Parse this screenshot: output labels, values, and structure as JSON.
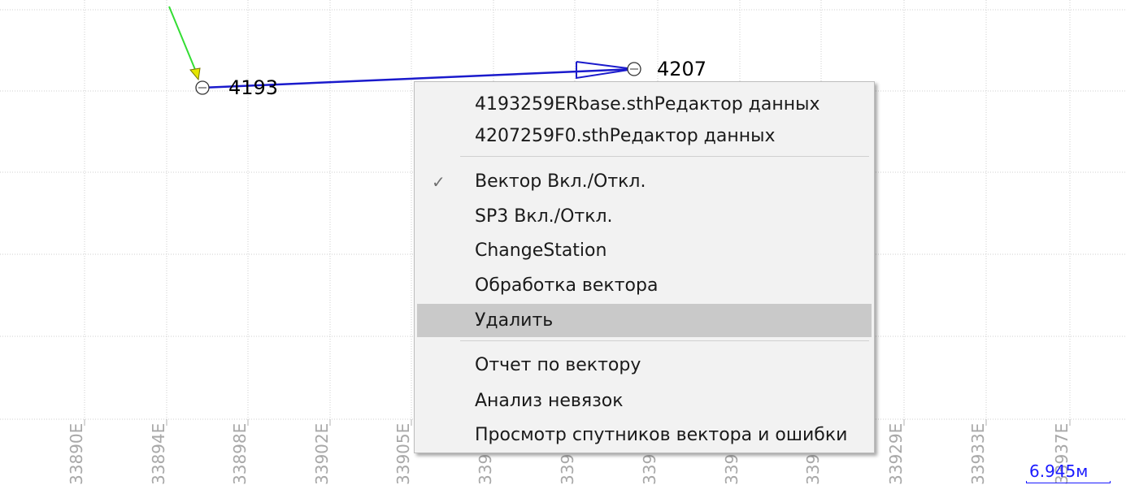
{
  "stations": [
    {
      "id": "4193"
    },
    {
      "id": "4207"
    }
  ],
  "axis_labels": [
    "3890E",
    "3894E",
    "3898E",
    "3902E",
    "3905E",
    "39",
    "39",
    "39",
    "39",
    "39",
    "3929E",
    "3933E",
    "3937E"
  ],
  "axis_prefix": "3",
  "scale": {
    "label": "6.945м"
  },
  "colors": {
    "vector": "#1a1acc",
    "incoming_vector": "#33dd33",
    "arrow_head": "#e6e600",
    "grid": "#cfcfcf",
    "menu_highlight": "#c9c9c9"
  },
  "context_menu": {
    "items": [
      {
        "label": "4193259ERbase.sthРедактор данных",
        "checked": false,
        "highlighted": false
      },
      {
        "label": "4207259F0.sthРедактор данных",
        "checked": false,
        "highlighted": false
      },
      {
        "label": "Вектор Вкл./Откл.",
        "checked": true,
        "highlighted": false
      },
      {
        "label": "SP3 Вкл./Откл.",
        "checked": false,
        "highlighted": false
      },
      {
        "label": "ChangeStation",
        "checked": false,
        "highlighted": false
      },
      {
        "label": "Обработка вектора",
        "checked": false,
        "highlighted": false
      },
      {
        "label": "Удалить",
        "checked": false,
        "highlighted": true
      },
      {
        "label": "Отчет по вектору",
        "checked": false,
        "highlighted": false
      },
      {
        "label": "Анализ невязок",
        "checked": false,
        "highlighted": false
      },
      {
        "label": "Просмотр спутников вектора и ошибки",
        "checked": false,
        "highlighted": false
      }
    ],
    "check_glyph": "✓"
  }
}
